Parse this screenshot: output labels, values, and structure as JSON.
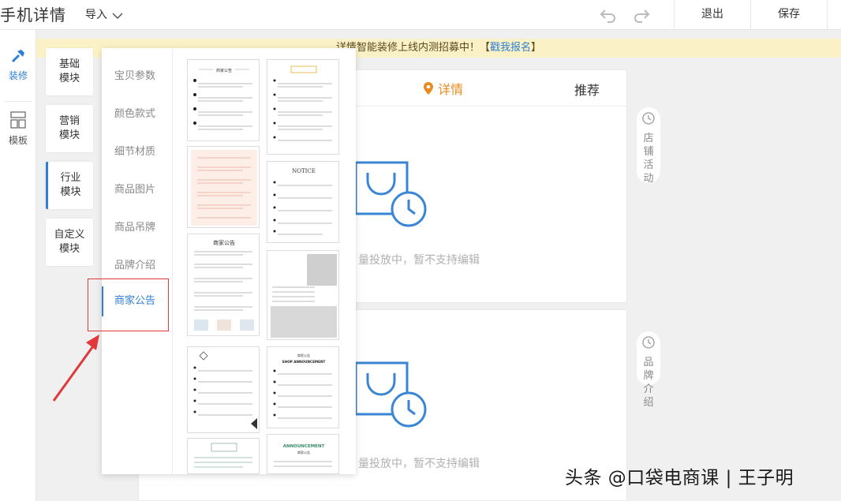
{
  "header": {
    "title": "手机详情",
    "import_label": "导入",
    "logout_label": "退出",
    "save_label": "保存"
  },
  "leftnav": {
    "decor_label": "装修",
    "template_label": "模板"
  },
  "notice": {
    "text": "详情智能装修上线内测招募中！【",
    "link": "戳我报名",
    "tail": "】"
  },
  "modules": [
    "基础模块",
    "营销模块",
    "行业模块",
    "自定义模块"
  ],
  "modules_lines": [
    [
      "基础",
      "模块"
    ],
    [
      "营销",
      "模块"
    ],
    [
      "行业",
      "模块"
    ],
    [
      "自定义",
      "模块"
    ]
  ],
  "categories": [
    "宝贝参数",
    "颜色款式",
    "细节材质",
    "商品图片",
    "商品吊牌",
    "品牌介绍",
    "商家公告"
  ],
  "active_category": "商家公告",
  "canvas": {
    "tab_detail": "详情",
    "tab_recommend": "推荐",
    "placeholder": "量投放中，暂不支持编辑"
  },
  "side_tags": [
    [
      "店",
      "铺",
      "活",
      "动"
    ],
    [
      "品",
      "牌",
      "介",
      "绍"
    ]
  ],
  "thumbnails": {
    "t1_title": "商家公告",
    "t3_title": "NOTICE",
    "t5_title": "商家公告",
    "t8_title": "SHOP ANNOUNCEMENT",
    "t8_sub": "商家公告",
    "t10_title": "ANNOUNCEMENT",
    "t10_sub": "商家公告"
  },
  "watermark": "头条 @口袋电商课 | 王子明",
  "colors": {
    "accent": "#2d7fd3",
    "orange": "#e88a1e",
    "notice_bg": "#fbf1c6",
    "highlight": "#e0383b"
  }
}
